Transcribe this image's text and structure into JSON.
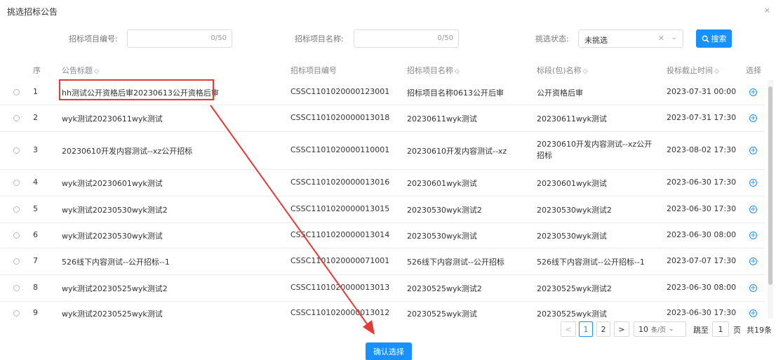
{
  "dialog": {
    "title": "挑选招标公告",
    "close": "×"
  },
  "filters": {
    "project_no_label": "招标项目编号:",
    "project_no_value": "",
    "project_no_counter": "0/50",
    "project_name_label": "招标项目名称:",
    "project_name_value": "",
    "project_name_counter": "0/50",
    "status_label": "挑选状态:",
    "status_value": "未挑选",
    "search_label": "搜索"
  },
  "table": {
    "columns": {
      "index": "序",
      "title": "公告标题",
      "project_no": "招标项目编号",
      "project_name": "招标项目名称",
      "lot_name": "标段(包)名称",
      "deadline": "投标截止时间",
      "select": "选择"
    },
    "rows": [
      {
        "index": "1",
        "title": "hh测试公开资格后审20230613公开资格后审",
        "project_no": "CSSC1101020000123001",
        "project_name": "招标项目名称0613公开后审",
        "lot_name": "公开资格后审",
        "deadline": "2023-07-31 00:00"
      },
      {
        "index": "2",
        "title": "wyk测试20230611wyk测试",
        "project_no": "CSSC1101020000013018",
        "project_name": "20230611wyk测试",
        "lot_name": "20230611wyk测试",
        "deadline": "2023-07-31 17:30"
      },
      {
        "index": "3",
        "title": "20230610开发内容测试--xz公开招标",
        "project_no": "CSSC1101020000110001",
        "project_name": "20230610开发内容测试--xz",
        "lot_name": "20230610开发内容测试--xz公开招标",
        "deadline": "2023-08-02 17:30"
      },
      {
        "index": "4",
        "title": "wyk测试20230601wyk测试",
        "project_no": "CSSC1101020000013016",
        "project_name": "20230601wyk测试",
        "lot_name": "20230601wyk测试",
        "deadline": "2023-06-30 17:30"
      },
      {
        "index": "5",
        "title": "wyk测试20230530wyk测试2",
        "project_no": "CSSC1101020000013015",
        "project_name": "20230530wyk测试2",
        "lot_name": "20230530wyk测试2",
        "deadline": "2023-06-30 17:30"
      },
      {
        "index": "6",
        "title": "wyk测试20230530wyk测试",
        "project_no": "CSSC1101020000013014",
        "project_name": "20230530wyk测试",
        "lot_name": "20230530wyk测试",
        "deadline": "2023-06-30 08:00"
      },
      {
        "index": "7",
        "title": "526线下内容测试--公开招标--1",
        "project_no": "CSSC1101020000071001",
        "project_name": "526线下内容测试--公开招标",
        "lot_name": "526线下内容测试--公开招标--1",
        "deadline": "2023-07-07 17:30"
      },
      {
        "index": "8",
        "title": "wyk测试20230525wyk测试2",
        "project_no": "CSSC1101020000013013",
        "project_name": "20230525wyk测试2",
        "lot_name": "20230525wyk测试2",
        "deadline": "2023-06-30 08:00"
      },
      {
        "index": "9",
        "title": "wyk测试20230525wyk测试",
        "project_no": "CSSC1101020000013012",
        "project_name": "20230525wyk测试",
        "lot_name": "20230525wyk测试",
        "deadline": "2023-06-30 17:30"
      }
    ]
  },
  "pagination": {
    "prev": "<",
    "pages": [
      "1",
      "2"
    ],
    "current": "1",
    "next": ">",
    "page_size": "10",
    "page_size_unit": "条/页",
    "jump_label": "跳至",
    "jump_value": "1",
    "page_unit": "页",
    "total": "共19条"
  },
  "confirm_label": "确认选择",
  "colors": {
    "accent": "#1890ff",
    "annotation": "#e53935"
  }
}
